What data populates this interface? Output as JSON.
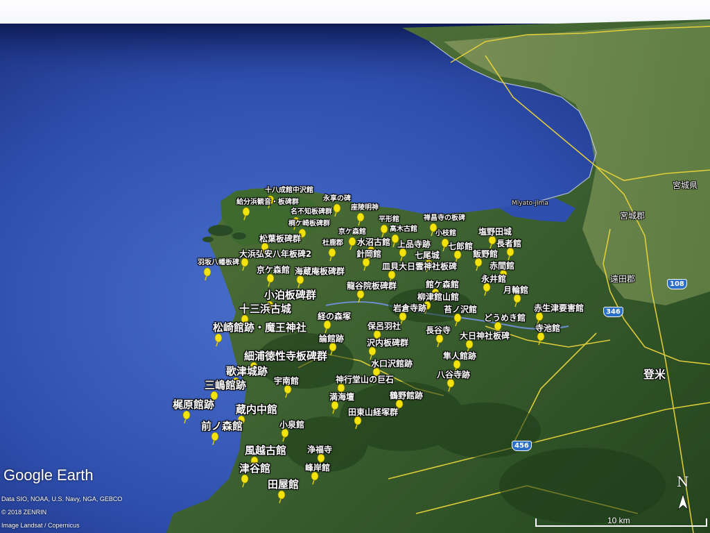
{
  "branding": {
    "logo_text": "Google Earth",
    "credits": [
      "Data SIO, NOAA, U.S. Navy, NGA, GEBCO",
      "© 2018 ZENRIN",
      "Image Landsat / Copernicus"
    ]
  },
  "scale": {
    "label": "10 km"
  },
  "compass": {
    "label": "N"
  },
  "colors": {
    "pin_yellow": "#f2e30c",
    "sea_deep": "#1c2f8a",
    "sea_light": "#3c64c4",
    "land_green": "#2d5a2a",
    "road_yellow": "#e8d23a",
    "highway_shield": "#2c6fc6"
  },
  "route_shields": [
    "346",
    "108",
    "456"
  ],
  "place_labels": {
    "tome": "登米",
    "toda_gun": "遠田郡",
    "miyagi_gun": "宮城郡",
    "miyagi_ken": "宮城県",
    "miyato_jima": "Miyato-jima"
  },
  "placemarks": [
    "十八成館中沢館",
    "給分浜観音・板碑群",
    "永享の碑",
    "名不知板碑群",
    "座陵明神",
    "桐ケ崎板碑群",
    "平形館",
    "禅昌寺の板碑",
    "京ケ森館",
    "高木古館",
    "小枝館",
    "塩野田城",
    "松葉板碑群",
    "杜鹿郡",
    "水沼古館",
    "上品寺跡",
    "七郎館",
    "長者館",
    "大浜弘安八年板碑2",
    "針岡館",
    "七尾城",
    "飯野館",
    "羽坂八幡板碑",
    "京ケ森館",
    "海蔵庵板碑群",
    "皿貝大日雲神社板碑",
    "赤間館",
    "永井館",
    "館ケ森館",
    "龍谷院板碑群",
    "小泊板碑群",
    "柳津館山館",
    "月輪館",
    "十三浜古城",
    "岩倉寺跡",
    "苔ノ沢館",
    "赤生津要害館",
    "経の森塚",
    "どうめき館",
    "松崎館跡・魔王神社",
    "保呂羽社",
    "長谷寺",
    "寺池館",
    "大日神社板碑",
    "論館跡",
    "沢内板碑群",
    "細浦徳性寺板碑群",
    "隼人館跡",
    "水口沢館跡",
    "歌津城跡",
    "八谷寺跡",
    "神行堂山の巨石",
    "三嶋館跡",
    "宇南館",
    "満海壇",
    "鶴野館跡",
    "梶原館跡",
    "蔵内中館",
    "田東山経塚群",
    "前ノ森館",
    "小泉館",
    "風越古館",
    "浄福寺",
    "津谷館",
    "峰岸館",
    "田屋館"
  ]
}
